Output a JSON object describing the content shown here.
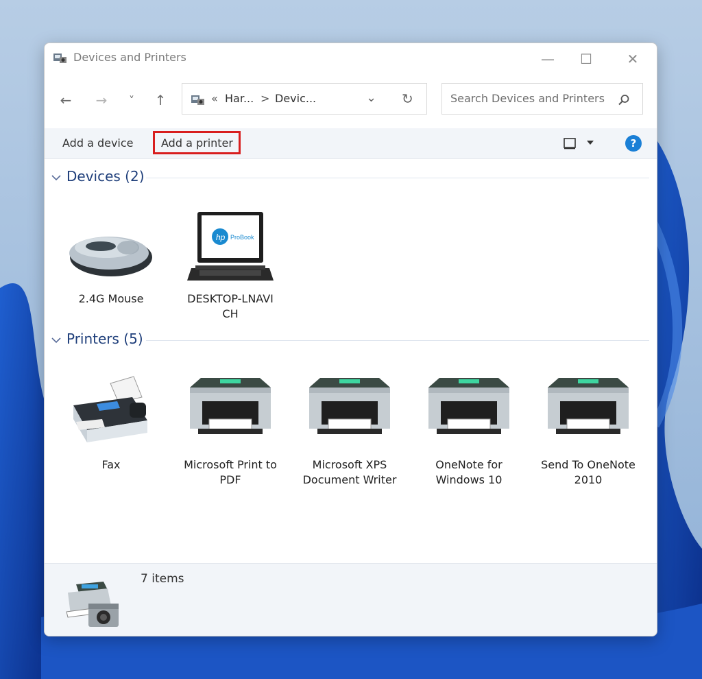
{
  "window": {
    "title": "Devices and Printers"
  },
  "title_controls": {
    "minimize": "—",
    "maximize": "☐",
    "close": "✕"
  },
  "nav": {
    "back": "←",
    "forward": "→",
    "recent": "˅",
    "up": "↑"
  },
  "address": {
    "overflow": "«",
    "segments": [
      "Har...",
      "Devic..."
    ],
    "separator": ">",
    "dropdown": "⌄",
    "refresh": "↻"
  },
  "search": {
    "placeholder": "Search Devices and Printers"
  },
  "toolbar": {
    "add_device": "Add a device",
    "add_printer": "Add a printer",
    "help": "?"
  },
  "groups": {
    "devices": {
      "title": "Devices (2)",
      "items": [
        {
          "label": "2.4G Mouse"
        },
        {
          "label": "DESKTOP-LNAVICH"
        }
      ]
    },
    "printers": {
      "title": "Printers (5)",
      "items": [
        {
          "label": "Fax"
        },
        {
          "label": "Microsoft Print to PDF"
        },
        {
          "label": "Microsoft XPS Document Writer"
        },
        {
          "label": "OneNote for Windows 10"
        },
        {
          "label": "Send To OneNote 2010"
        }
      ]
    }
  },
  "laptop_screen": {
    "brand": "hp",
    "model": "ProBook"
  },
  "status": {
    "count": "7 items"
  },
  "colors": {
    "highlight": "#d81e1e",
    "group_title": "#1e3e7a",
    "help": "#1a7fd6"
  }
}
